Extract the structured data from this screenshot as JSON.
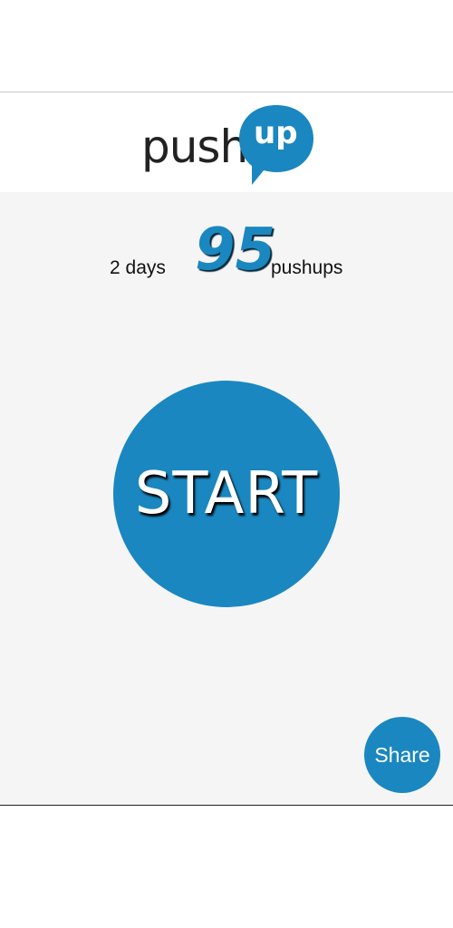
{
  "logo": {
    "text_push": "push",
    "text_up": "up"
  },
  "stats": {
    "days_label": "2 days",
    "pushup_count": "95",
    "unit_label": "pushups"
  },
  "actions": {
    "start_label": "START",
    "share_label": "Share"
  },
  "colors": {
    "accent": "#1a87c0",
    "background": "#f5f5f5",
    "header_background": "#ffffff"
  }
}
